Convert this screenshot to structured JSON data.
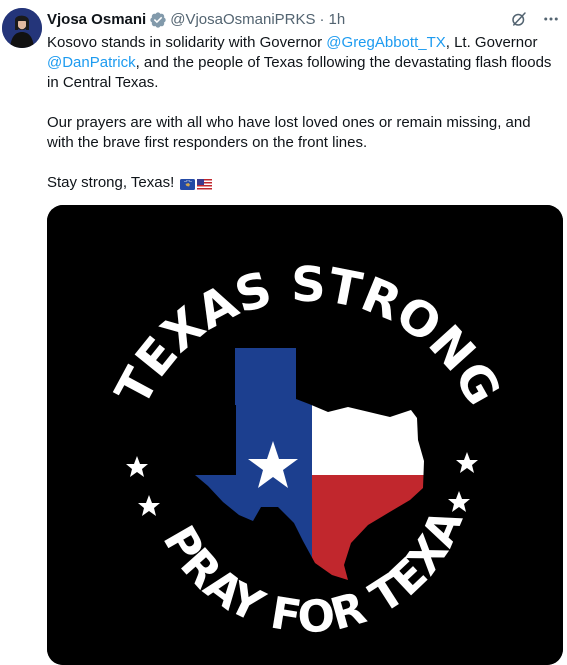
{
  "tweet": {
    "display_name": "Vjosa Osmani",
    "handle": "@VjosaOsmaniPRKS",
    "separator": "·",
    "time": "1h",
    "verified_icon": "verified-badge-icon",
    "actions": {
      "grok_icon": "grok-icon",
      "more_icon": "more-horizontal-icon",
      "more_label": "···"
    },
    "text": {
      "p1_before": "Kosovo stands in solidarity with Governor ",
      "mention1": "@GregAbbott_TX",
      "p1_middle": ", Lt. Governor ",
      "mention2": "@DanPatrick",
      "p1_after": ", and the people of Texas following the devastating flash floods in Central Texas.",
      "p2": "Our prayers are with all who have lost loved ones or remain missing, and with the brave first responders on the front lines.",
      "p3": "Stay strong, Texas! ",
      "flags": [
        "kosovo-flag-icon",
        "us-flag-icon"
      ]
    },
    "media": {
      "top_text": "TEXAS STRONG",
      "bottom_text": "# PRAY FOR TEXAS",
      "colors": {
        "background": "#000000",
        "blue": "#1c3f8f",
        "red": "#c1272d",
        "white": "#ffffff"
      }
    }
  },
  "colors": {
    "link": "#1d9bf0",
    "secondary_text": "#536471",
    "primary_text": "#0f1419",
    "verified": "#829aab"
  }
}
